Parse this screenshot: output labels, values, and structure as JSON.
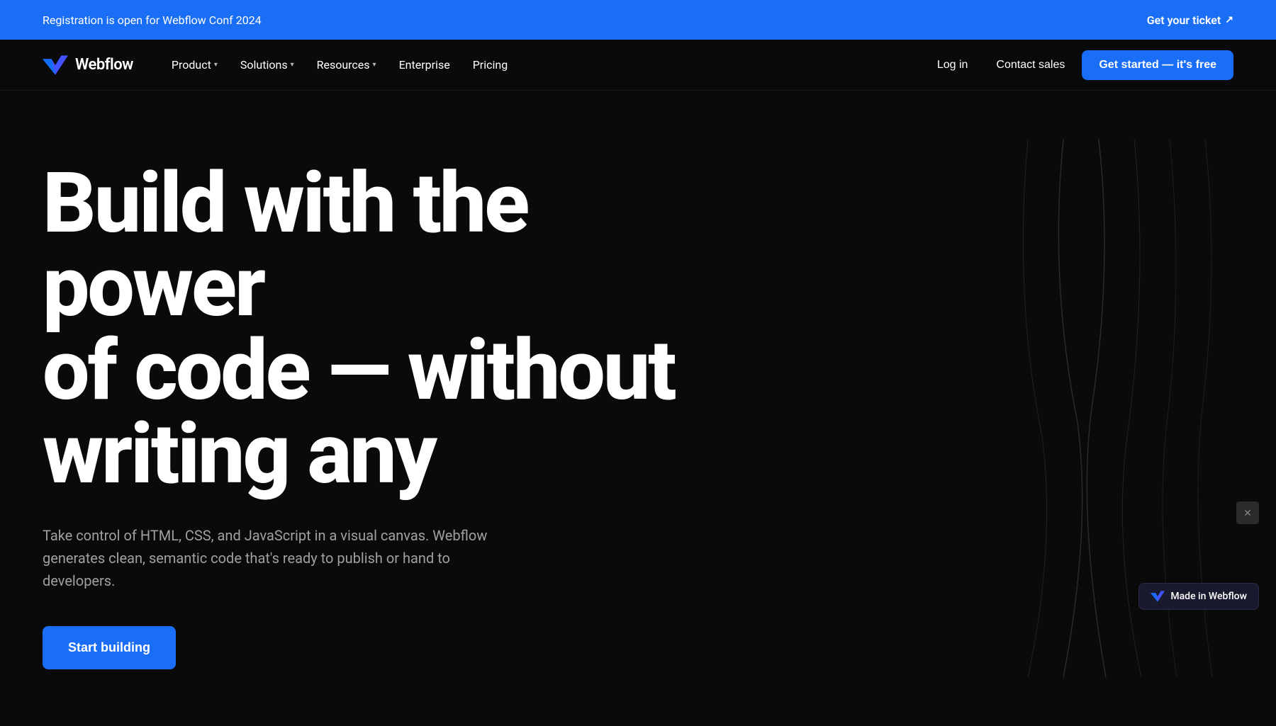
{
  "announcement": {
    "text": "Registration is open for Webflow Conf 2024",
    "link_text": "Get your ticket",
    "link_arrow": "↗"
  },
  "navbar": {
    "logo_text": "Webflow",
    "nav_items": [
      {
        "label": "Product",
        "has_dropdown": true
      },
      {
        "label": "Solutions",
        "has_dropdown": true
      },
      {
        "label": "Resources",
        "has_dropdown": true
      },
      {
        "label": "Enterprise",
        "has_dropdown": false
      },
      {
        "label": "Pricing",
        "has_dropdown": false
      }
    ],
    "login_label": "Log in",
    "contact_label": "Contact sales",
    "cta_label": "Get started — it's free"
  },
  "hero": {
    "headline_line1": "Build with the power",
    "headline_line2": "of code — without",
    "headline_line3": "writing any",
    "subtext": "Take control of HTML, CSS, and JavaScript in a visual canvas. Webflow generates clean, semantic code that's ready to publish or hand to developers.",
    "cta_label": "Start building"
  },
  "made_in_webflow": {
    "label": "Made in Webflow"
  },
  "colors": {
    "accent": "#1a6ef5",
    "bg": "#0a0a0a",
    "announcement_bg": "#1a6ef5"
  }
}
